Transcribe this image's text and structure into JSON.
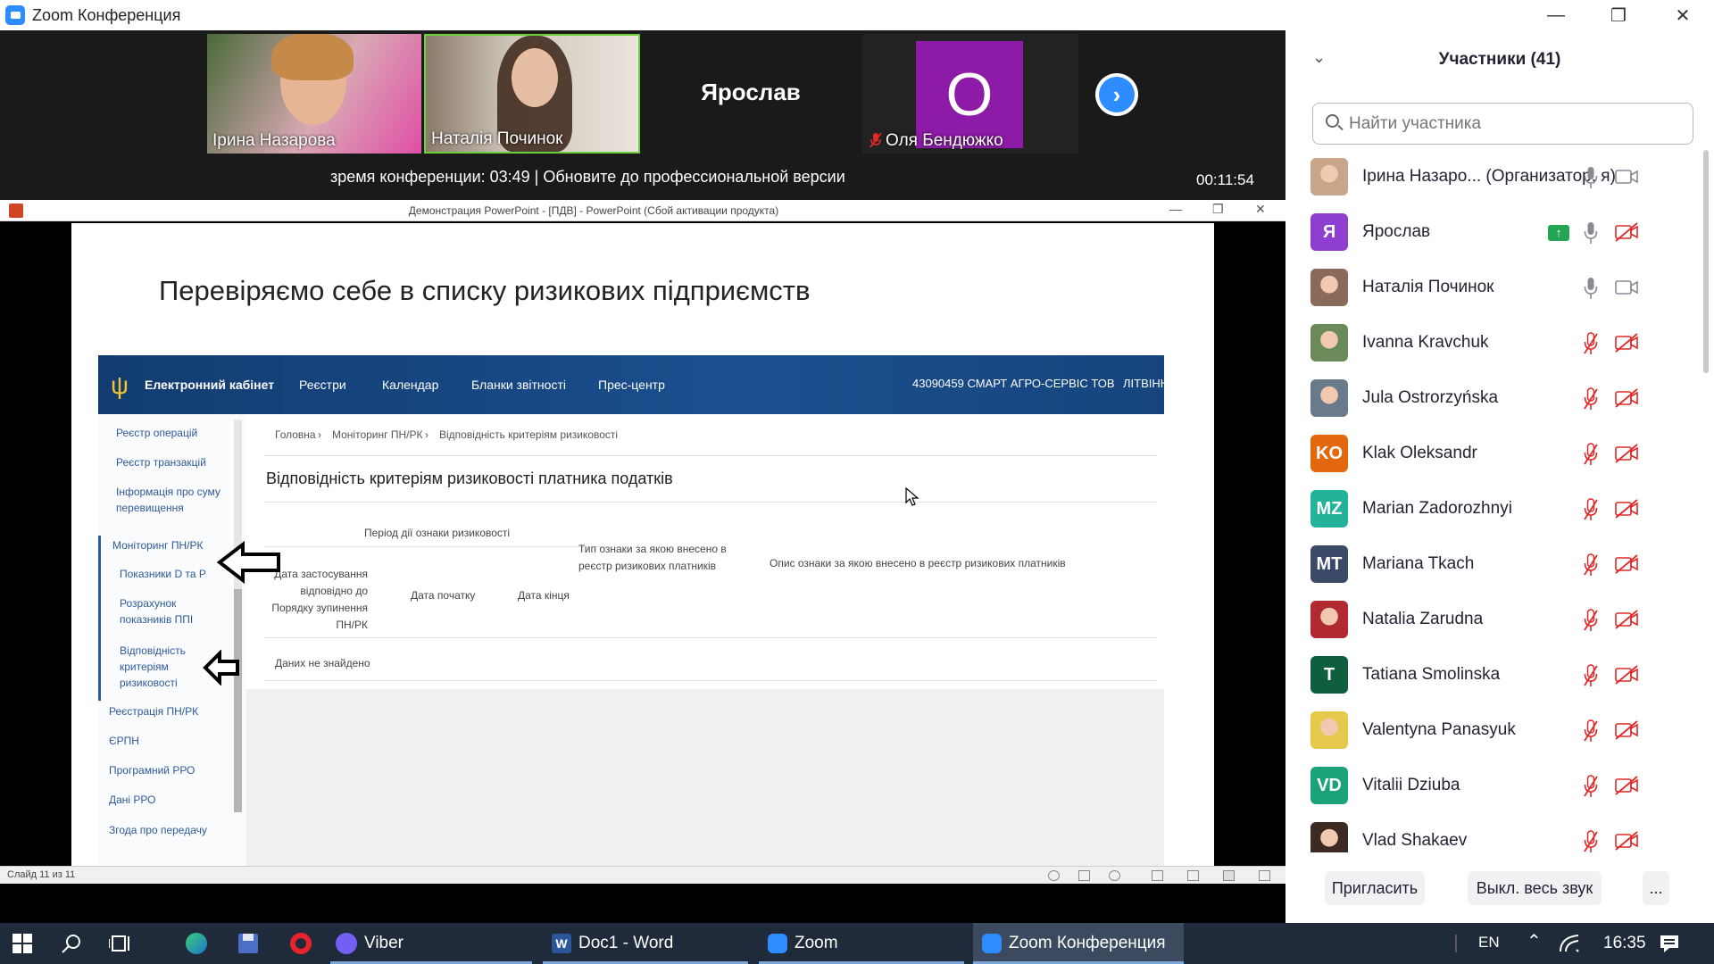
{
  "window": {
    "title": "Zoom Конференция"
  },
  "filmstrip": {
    "tiles": [
      {
        "name": "Ірина Назарова"
      },
      {
        "name": "Наталія Починок"
      },
      {
        "name": "Ярослав"
      },
      {
        "name": "Оля Бендюжко",
        "avatar_letter": "O"
      }
    ],
    "next_icon": "chevron-right-icon",
    "notice": "зремя конференции: 03:49 | Обновите до профессиональной версии",
    "timer": "00:11:54"
  },
  "ppt": {
    "window_title": "Демонстрация PowerPoint - [ПДВ] - PowerPoint (Сбой активации продукта)",
    "slide_title": "Перевіряємо себе в списку ризикових підприємств",
    "status": "Слайд 11 из 11"
  },
  "cabinet": {
    "brand": "Електронний кабінет",
    "menu": [
      "Реєстри",
      "Календар",
      "Бланки звітності",
      "Прес-центр"
    ],
    "org": "43090459 СМАРТ АГРО-СЕРВІС ТОВ",
    "user": "ЛІТВІНЮ",
    "side": {
      "op_registry": "Реєстр операцій",
      "tx_registry": "Реєстр транзакцій",
      "excess_info": "Інформація про суму перевищення",
      "monitoring": "Моніторинг ПН/РК",
      "indicators": "Показники D та P",
      "ppi_calc": "Розрахунок показників ППІ",
      "risk_match": "Відповідність критеріям ризиковості",
      "pn_registration": "Реєстрація ПН/РК",
      "erpn": "ЄРПН",
      "software_rro": "Програмний РРО",
      "rro_data": "Дані РРО",
      "consent": "Згода про передачу"
    },
    "crumbs": [
      "Головна",
      "Моніторинг ПН/РК",
      "Відповідність критеріям ризиковості"
    ],
    "heading": "Відповідність критеріям ризиковості платника податків",
    "period_header": "Період дії ознаки ризиковості",
    "col_applied": "Дата застосування відповідно до Порядку зупинення ПН/РК",
    "col_start": "Дата початку",
    "col_end": "Дата кінця",
    "col_type": "Тип ознаки за якою внесено в реєстр ризикових платників",
    "col_desc": "Опис ознаки за якою внесено в реєстр ризикових платників",
    "no_data": "Даних не знайдено"
  },
  "panel": {
    "title": "Участники (41)",
    "search_placeholder": "Найти участника",
    "participants": [
      {
        "name": "Ірина Назаро... (Организатор, я)",
        "avatar_color": "#c9a58a",
        "mic": "on",
        "cam": "on"
      },
      {
        "name": "Ярослав",
        "avatar_text": "Я",
        "avatar_color": "#8e3fd0",
        "mic": "on",
        "cam": "off",
        "sharing": true
      },
      {
        "name": "Наталія Починок",
        "avatar_color": "#8a6a5a",
        "mic": "on",
        "cam": "on"
      },
      {
        "name": "Ivanna Kravchuk",
        "avatar_color": "#6a8a5a",
        "mic": "off",
        "cam": "off"
      },
      {
        "name": "Jula Ostrorzyńska",
        "avatar_color": "#6a7a8a",
        "mic": "off",
        "cam": "off"
      },
      {
        "name": "Klak Oleksandr",
        "avatar_text": "KO",
        "avatar_color": "#e3670d",
        "mic": "off",
        "cam": "off"
      },
      {
        "name": "Marian Zadorozhnyi",
        "avatar_text": "MZ",
        "avatar_color": "#23b39a",
        "mic": "off",
        "cam": "off"
      },
      {
        "name": "Mariana Tkach",
        "avatar_text": "MT",
        "avatar_color": "#3b4a66",
        "mic": "off",
        "cam": "off"
      },
      {
        "name": "Natalia Zarudna",
        "avatar_color": "#b02a30",
        "mic": "off",
        "cam": "off"
      },
      {
        "name": "Tatiana Smolinska",
        "avatar_text": "T",
        "avatar_color": "#0f5e3f",
        "mic": "off",
        "cam": "off"
      },
      {
        "name": "Valentyna Panasyuk",
        "avatar_color": "#e6c84a",
        "mic": "off",
        "cam": "off"
      },
      {
        "name": "Vitalii Dziuba",
        "avatar_text": "VD",
        "avatar_color": "#1aa37a",
        "mic": "off",
        "cam": "off"
      },
      {
        "name": "Vlad Shakaev",
        "avatar_color": "#3a2a22",
        "mic": "off",
        "cam": "off"
      }
    ],
    "invite": "Пригласить",
    "mute_all": "Выкл. весь звук",
    "more": "..."
  },
  "taskbar": {
    "apps": [
      {
        "label": "Viber",
        "color": "#7360f2"
      },
      {
        "label": "Doc1 - Word",
        "color": "#2b579a"
      },
      {
        "label": "Zoom",
        "color": "#2d8cff"
      },
      {
        "label": "Zoom Конференция",
        "color": "#2d8cff"
      }
    ],
    "lang": "EN",
    "time": "16:35"
  }
}
